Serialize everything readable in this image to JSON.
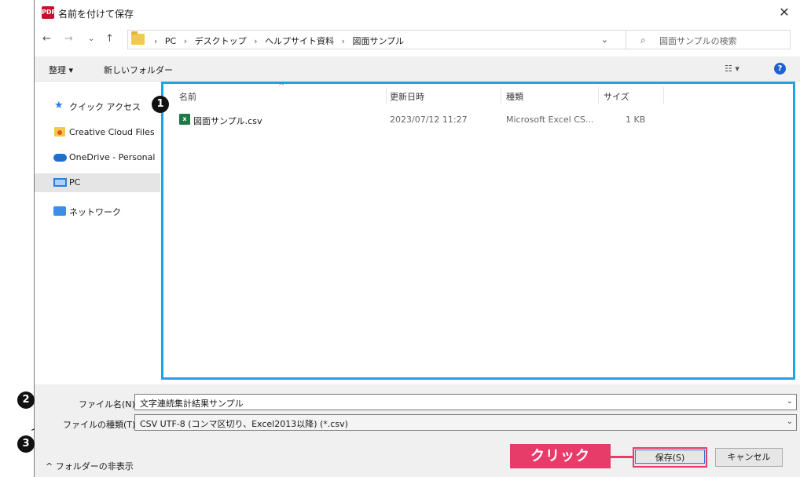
{
  "window": {
    "title": "名前を付けて保存",
    "app_icon_label": "PDF",
    "close_glyph": "✕"
  },
  "nav": {
    "back": "←",
    "forward": "→",
    "recent": "⌄",
    "up": "↑",
    "breadcrumbs": [
      "PC",
      "デスクトップ",
      "ヘルプサイト資料",
      "図面サンプル"
    ],
    "breadcrumb_sep": "›",
    "dropdown_glyph": "⌄",
    "refresh_glyph": "↻",
    "search_placeholder": "図面サンプルの検索",
    "search_glyph": "⌕"
  },
  "toolbar": {
    "organize": "整理 ▾",
    "new_folder": "新しいフォルダー",
    "view_glyph": "☷ ▾",
    "help_glyph": "?"
  },
  "sidebar": {
    "items": [
      {
        "label": "クイック アクセス"
      },
      {
        "label": "Creative Cloud Files"
      },
      {
        "label": "OneDrive - Personal"
      },
      {
        "label": "PC"
      },
      {
        "label": "ネットワーク"
      }
    ]
  },
  "filelist": {
    "columns": [
      "名前",
      "更新日時",
      "種類",
      "サイズ"
    ],
    "sort_glyph": "^",
    "rows": [
      {
        "name": "図面サンプル.csv",
        "modified": "2023/07/12 11:27",
        "type": "Microsoft Excel CS...",
        "size": "1 KB",
        "icon_label": "x"
      }
    ]
  },
  "badges": {
    "one": "1",
    "two": "2",
    "three": "3"
  },
  "form": {
    "filename_label": "ファイル名(N):",
    "filename_value": "文字連続集計結果サンプル",
    "filetype_label": "ファイルの種類(T):",
    "filetype_value": "CSV UTF-8 (コンマ区切り、Excel2013以降) (*.csv)",
    "drop_glyph": "⌄",
    "hide_folders": "^ フォルダーの非表示",
    "click_label": "クリック",
    "save": "保存(S)",
    "cancel": "キャンセル"
  },
  "colors": {
    "highlight_border": "#1fa3e8",
    "callout": "#e73b6a",
    "accent": "#2b79d8"
  }
}
